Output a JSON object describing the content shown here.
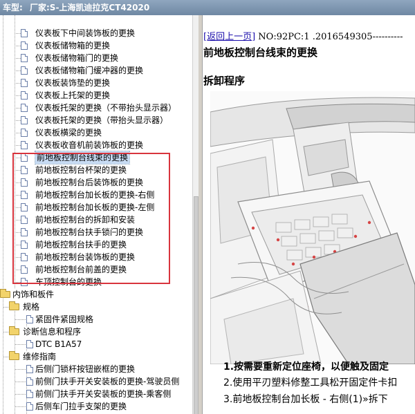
{
  "titlebar": {
    "model_label": "车型:",
    "maker": "厂家:S-上海凯迪拉克CT42020"
  },
  "tree": {
    "items": [
      {
        "label": "仪表板下中间装饰板的更换",
        "type": "doc"
      },
      {
        "label": "仪表板储物箱的更换",
        "type": "doc"
      },
      {
        "label": "仪表板储物箱门的更换",
        "type": "doc"
      },
      {
        "label": "仪表板储物箱门缓冲器的更换",
        "type": "doc"
      },
      {
        "label": "仪表板装饰垫的更换",
        "type": "doc"
      },
      {
        "label": "仪表板上托架的更换",
        "type": "doc"
      },
      {
        "label": "仪表板托架的更换（不带抬头显示器）",
        "type": "doc"
      },
      {
        "label": "仪表板托架的更换（带抬头显示器）",
        "type": "doc"
      },
      {
        "label": "仪表板横梁的更换",
        "type": "doc"
      },
      {
        "label": "仪表板收音机前装饰板的更换",
        "type": "doc"
      },
      {
        "label": "前地板控制台线束的更换",
        "type": "doc",
        "selected": true
      },
      {
        "label": "前地板控制台杯架的更换",
        "type": "doc"
      },
      {
        "label": "前地板控制台后装饰板的更换",
        "type": "doc"
      },
      {
        "label": "前地板控制台加长板的更换-右侧",
        "type": "doc"
      },
      {
        "label": "前地板控制台加长板的更换-左侧",
        "type": "doc"
      },
      {
        "label": "前地板控制台的拆卸和安装",
        "type": "doc"
      },
      {
        "label": "前地板控制台扶手锁闩的更换",
        "type": "doc"
      },
      {
        "label": "前地板控制台扶手的更换",
        "type": "doc"
      },
      {
        "label": "前地板控制台装饰板的更换",
        "type": "doc"
      },
      {
        "label": "前地板控制台前盖的更换",
        "type": "doc"
      },
      {
        "label": "车顶控制台的更换",
        "type": "doc"
      },
      {
        "label": "内饰和板件",
        "type": "folder",
        "level": 0
      },
      {
        "label": "规格",
        "type": "folder",
        "level": 1
      },
      {
        "label": "紧固件紧固规格",
        "type": "doc",
        "level": 2
      },
      {
        "label": "诊断信息和程序",
        "type": "folder",
        "level": 1
      },
      {
        "label": "DTC B1A57",
        "type": "doc",
        "level": 2
      },
      {
        "label": "维修指南",
        "type": "folder",
        "level": 1
      },
      {
        "label": "后侧门锁杆按钮嵌框的更换",
        "type": "doc",
        "level": 2
      },
      {
        "label": "前侧门扶手开关安装板的更换-驾驶员侧",
        "type": "doc",
        "level": 2
      },
      {
        "label": "前侧门扶手开关安装板的更换-乘客侧",
        "type": "doc",
        "level": 2
      },
      {
        "label": "后侧车门拉手支架的更换",
        "type": "doc",
        "level": 2
      }
    ]
  },
  "content": {
    "back_link": "[返回上一页]",
    "doc_no": " NO:92PC:1 .2016549305----------",
    "title": "前地板控制台线束的更换",
    "section": "拆卸程序",
    "steps": [
      "1.按需要重新定位座椅，以便触及固定",
      "2.使用平刃塑料修整工具松开固定件卡扣",
      "3.前地板控制台加长板 - 右侧(1)»拆下"
    ]
  },
  "colors": {
    "highlight": "#d8343d",
    "selection": "#c7dbf3",
    "link": "#1a0dab"
  }
}
